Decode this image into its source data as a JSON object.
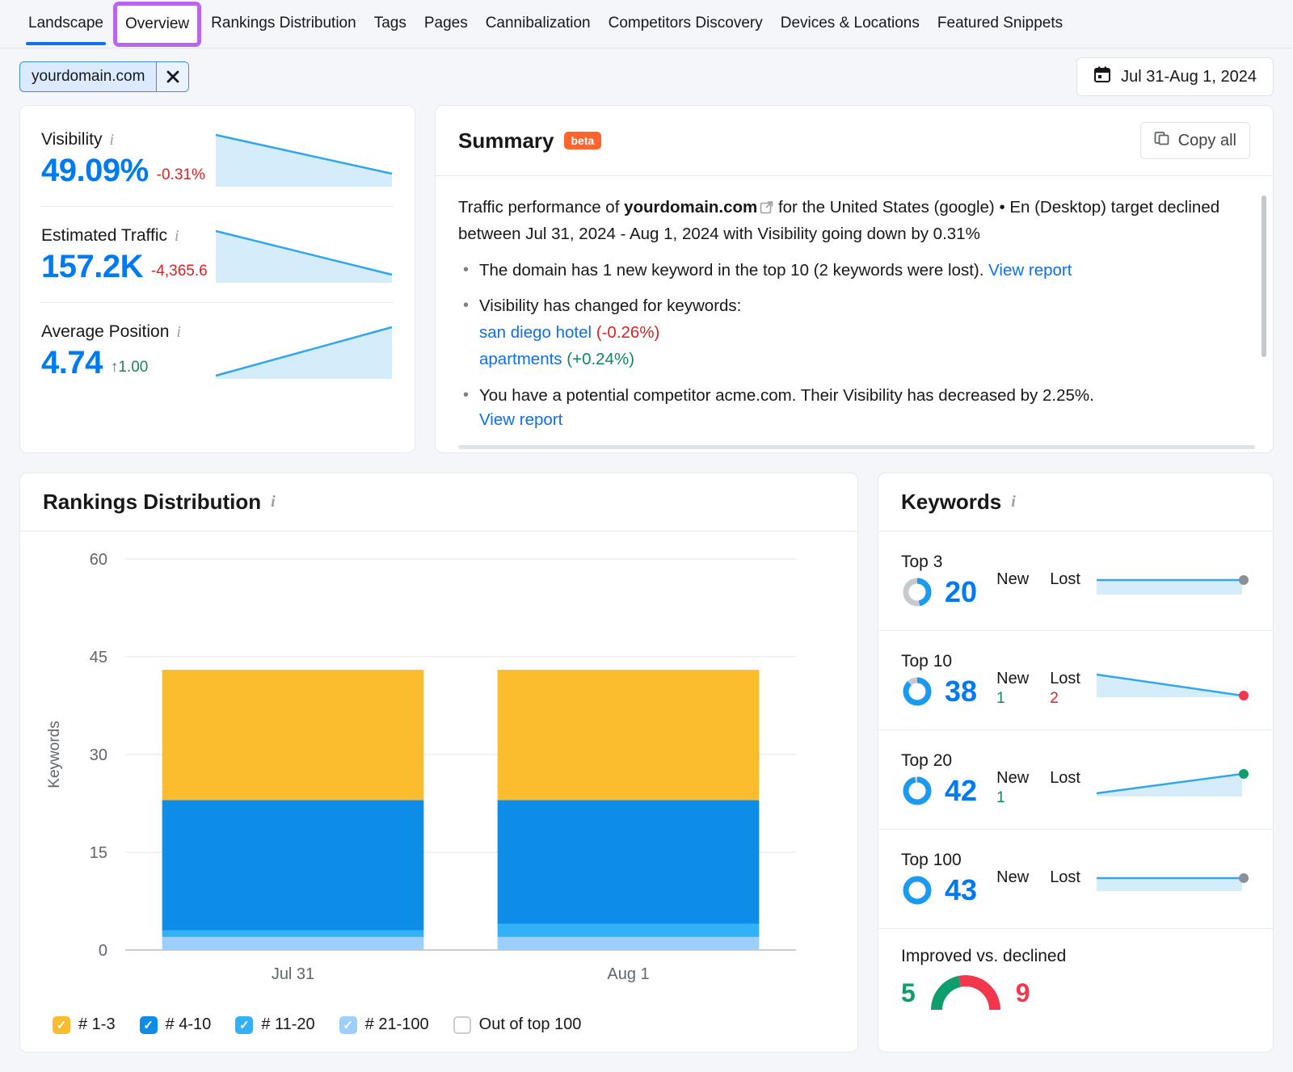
{
  "nav": {
    "items": [
      {
        "label": "Landscape",
        "state": "active"
      },
      {
        "label": "Overview",
        "state": "highlighted"
      },
      {
        "label": "Rankings Distribution",
        "state": "normal"
      },
      {
        "label": "Tags",
        "state": "normal"
      },
      {
        "label": "Pages",
        "state": "normal"
      },
      {
        "label": "Cannibalization",
        "state": "normal"
      },
      {
        "label": "Competitors Discovery",
        "state": "normal"
      },
      {
        "label": "Devices & Locations",
        "state": "normal"
      },
      {
        "label": "Featured Snippets",
        "state": "normal"
      }
    ]
  },
  "filter": {
    "domain": "yourdomain.com",
    "close_icon": "close-icon",
    "date_icon": "calendar-icon",
    "date_range": "Jul 31-Aug 1, 2024"
  },
  "metrics": [
    {
      "label": "Visibility",
      "value": "49.09%",
      "delta": "-0.31%",
      "direction": "down",
      "trend": "down",
      "info_icon": "info-icon"
    },
    {
      "label": "Estimated Traffic",
      "value": "157.2K",
      "delta": "-4,365.6",
      "direction": "down",
      "trend": "down",
      "info_icon": "info-icon"
    },
    {
      "label": "Average Position",
      "value": "4.74",
      "delta": "↑1.00",
      "direction": "up",
      "trend": "up",
      "info_icon": "info-icon"
    }
  ],
  "summary": {
    "title": "Summary",
    "badge": "beta",
    "copy_label": "Copy all",
    "copy_icon": "copy-icon",
    "intro_1": "Traffic performance of ",
    "intro_domain": "yourdomain.com",
    "external_icon": "external-link-icon",
    "intro_2": " for the United States (google) • En (Desktop) target declined between Jul 31, 2024 - Aug 1, 2024 with Visibility going down by 0.31%",
    "bullets": [
      {
        "text": "The domain has 1 new keyword in the top 10 (2 keywords were lost). ",
        "link": "View report"
      }
    ],
    "bullet2_text": "Visibility has changed for keywords:",
    "keywords": [
      {
        "name": "san diego hotel",
        "change": "(-0.26%)",
        "dir": "down"
      },
      {
        "name": "apartments",
        "change": "(+0.24%)",
        "dir": "up"
      }
    ],
    "bullet3_text": "You have a potential competitor acme.com. Their Visibility has decreased by 2.25%.",
    "bullet3_link": "View report"
  },
  "rankings": {
    "title": "Rankings Distribution",
    "info_icon": "info-icon",
    "legend": [
      {
        "label": "# 1-3",
        "color": "#fbbc2e",
        "checked": true
      },
      {
        "label": "# 4-10",
        "color": "#0d8ce8",
        "checked": true
      },
      {
        "label": "# 11-20",
        "color": "#33b1f7",
        "checked": true
      },
      {
        "label": "# 21-100",
        "color": "#9ccffb",
        "checked": true
      },
      {
        "label": "Out of top 100",
        "color": "#ffffff",
        "checked": false
      }
    ]
  },
  "chart_data": {
    "type": "bar",
    "title": "Rankings Distribution",
    "xlabel": "",
    "ylabel": "Keywords",
    "categories": [
      "Jul 31",
      "Aug 1"
    ],
    "ylim": [
      0,
      60
    ],
    "yticks": [
      0,
      15,
      30,
      45,
      60
    ],
    "grid": true,
    "stacked": true,
    "legend_position": "bottom",
    "series": [
      {
        "name": "# 21-100",
        "color": "#9ccffb",
        "values": [
          2,
          2
        ]
      },
      {
        "name": "# 11-20",
        "color": "#33b1f7",
        "values": [
          1,
          2
        ]
      },
      {
        "name": "# 4-10",
        "color": "#0d8ce8",
        "values": [
          20,
          19
        ]
      },
      {
        "name": "# 1-3",
        "color": "#fbbc2e",
        "values": [
          20,
          20
        ]
      }
    ],
    "totals": [
      43,
      43
    ]
  },
  "keywords_panel": {
    "title": "Keywords",
    "info_icon": "info-icon",
    "new_label": "New",
    "lost_label": "Lost",
    "rows": [
      {
        "label": "Top 3",
        "value": "20",
        "donut_pct": 47,
        "new": "",
        "lost": "",
        "trend": "flat",
        "dot_color": "#8b9096"
      },
      {
        "label": "Top 10",
        "value": "38",
        "donut_pct": 88,
        "new": "1",
        "lost": "2",
        "trend": "down",
        "dot_color": "#f2364c"
      },
      {
        "label": "Top 20",
        "value": "42",
        "donut_pct": 97,
        "new": "1",
        "lost": "",
        "trend": "up",
        "dot_color": "#0f9d6e"
      },
      {
        "label": "Top 100",
        "value": "43",
        "donut_pct": 100,
        "new": "",
        "lost": "",
        "trend": "flat",
        "dot_color": "#8b9096"
      }
    ],
    "improved_title": "Improved vs. declined",
    "improved_count": "5",
    "declined_count": "9",
    "improved_color": "#0f9d6e",
    "declined_color": "#f2364c"
  }
}
